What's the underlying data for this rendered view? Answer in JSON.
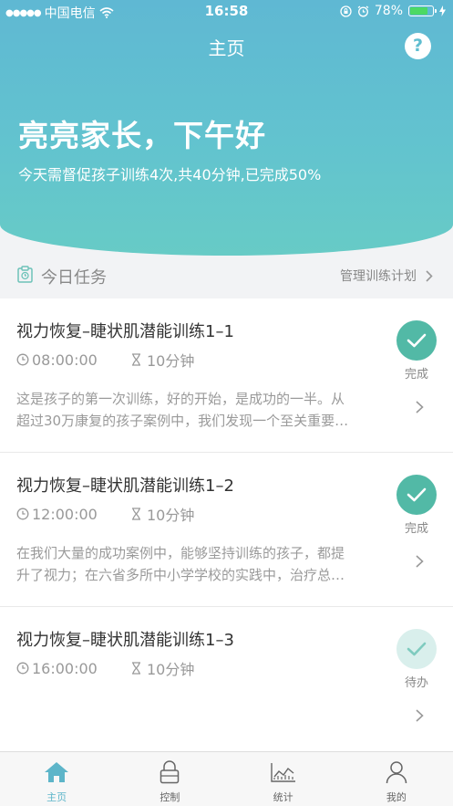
{
  "status_bar": {
    "carrier": "中国电信",
    "time": "16:58",
    "battery": "78%"
  },
  "nav": {
    "title": "主页",
    "help_label": "?"
  },
  "hero": {
    "greeting": "亮亮家长，下午好",
    "summary": "今天需督促孩子训练4次,共40分钟,已完成50%"
  },
  "section": {
    "title": "今日任务",
    "manage_label": "管理训练计划"
  },
  "tasks": [
    {
      "name": "视力恢复–睫状肌潜能训练1–1",
      "time": "08:00:00",
      "duration": "10分钟",
      "desc_line1": "这是孩子的第一次训练，好的开始，是成功的一半。从",
      "desc_line2": "超过30万康复的孩子案例中，我们发现一个至关重要…",
      "status": "完成"
    },
    {
      "name": "视力恢复–睫状肌潜能训练1–2",
      "time": "12:00:00",
      "duration": "10分钟",
      "desc_line1": "在我们大量的成功案例中，能够坚持训练的孩子，都提",
      "desc_line2": "升了视力；在六省多所中小学学校的实践中，治疗总…",
      "status": "完成"
    },
    {
      "name": "视力恢复–睫状肌潜能训练1–3",
      "time": "16:00:00",
      "duration": "10分钟",
      "desc_line1": "",
      "desc_line2": "",
      "status": "待办"
    }
  ],
  "tabbar": [
    {
      "label": "主页",
      "icon": "home-icon",
      "active": true
    },
    {
      "label": "控制",
      "icon": "lock-icon",
      "active": false
    },
    {
      "label": "统计",
      "icon": "chart-icon",
      "active": false
    },
    {
      "label": "我的",
      "icon": "person-icon",
      "active": false
    }
  ],
  "colors": {
    "accent": "#5fb8d3",
    "done": "#52b9a6",
    "todo": "#d9efec",
    "tab_active": "#5db5c9"
  }
}
